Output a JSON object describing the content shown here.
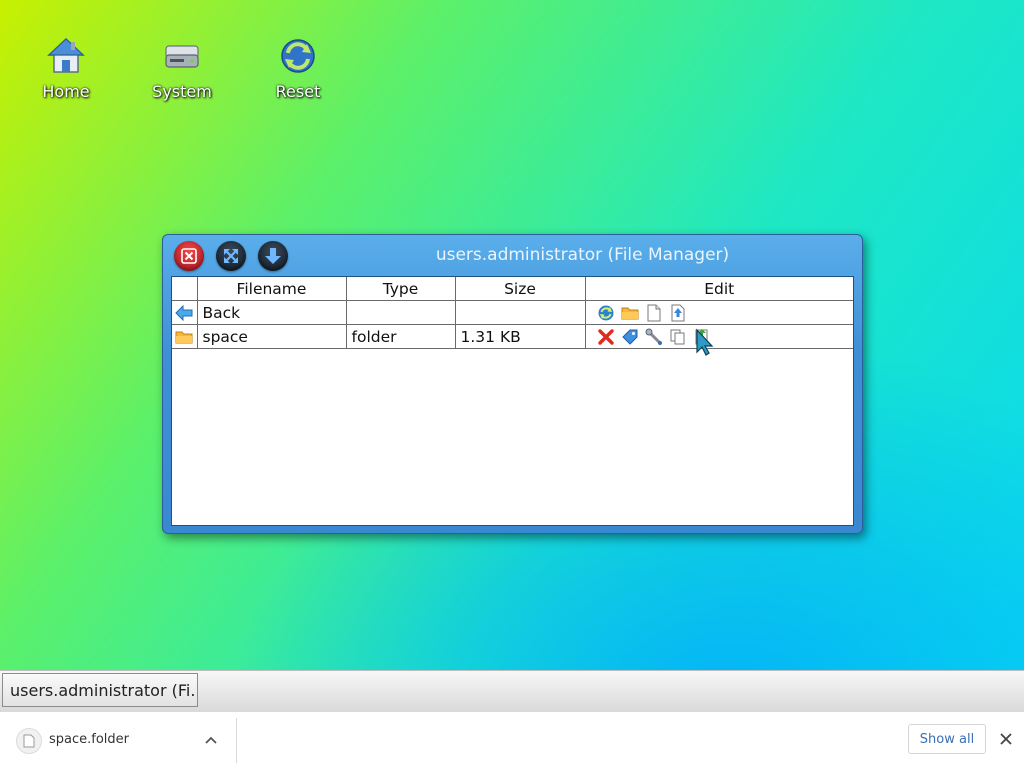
{
  "desktop": {
    "icons": [
      {
        "label": "Home",
        "icon": "home-icon"
      },
      {
        "label": "System",
        "icon": "drive-icon"
      },
      {
        "label": "Reset",
        "icon": "reset-icon"
      }
    ]
  },
  "window": {
    "title": "users.administrator (File Manager)",
    "controls": {
      "close": "close-icon",
      "maximize": "maximize-icon",
      "minimize": "minimize-icon"
    },
    "table": {
      "headers": {
        "icon": "",
        "filename": "Filename",
        "type": "Type",
        "size": "Size",
        "edit": "Edit"
      },
      "rows": [
        {
          "icon": "back-arrow-icon",
          "filename": "Back",
          "type": "",
          "size": "",
          "edit_icons": [
            "refresh-icon",
            "new-folder-icon",
            "new-file-icon",
            "upload-icon"
          ]
        },
        {
          "icon": "folder-icon",
          "filename": "space",
          "type": "folder",
          "size": "1.31 KB",
          "edit_icons": [
            "delete-icon",
            "rename-tag-icon",
            "properties-wrench-icon",
            "copy-icon",
            "move-icon"
          ]
        }
      ]
    }
  },
  "taskbar": {
    "items": [
      {
        "label": "users.administrator (Fi..."
      }
    ]
  },
  "download_bar": {
    "filename": "space.folder",
    "show_all_label": "Show all"
  },
  "colors": {
    "window_blue": "#3f8fd6",
    "close_red": "#c21a24",
    "link_blue": "#3b6fb6"
  }
}
